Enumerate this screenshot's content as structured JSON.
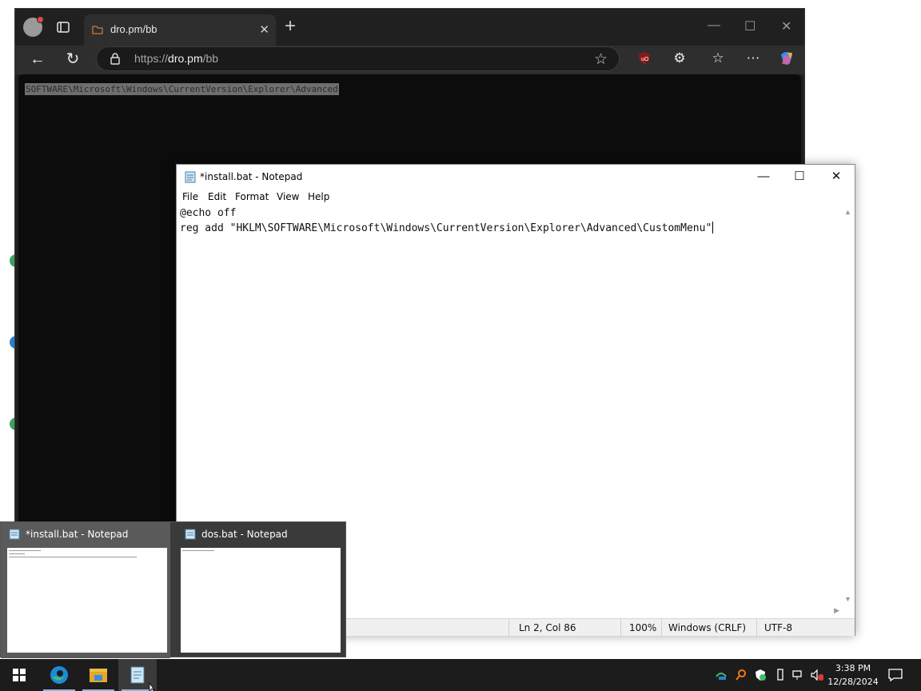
{
  "browser": {
    "tab_title": "dro.pm/bb",
    "url_scheme": "https://",
    "url_host": "dro.pm",
    "url_path": "/bb",
    "content_text": "SOFTWARE\\Microsoft\\Windows\\CurrentVersion\\Explorer\\Advanced"
  },
  "notepad": {
    "title": "*install.bat - Notepad",
    "menu": [
      "File",
      "Edit",
      "Format",
      "View",
      "Help"
    ],
    "lines": [
      "@echo off",
      "reg add \"HKLM\\SOFTWARE\\Microsoft\\Windows\\CurrentVersion\\Explorer\\Advanced\\CustomMenu\""
    ],
    "status": {
      "position": "Ln 2, Col 86",
      "zoom": "100%",
      "line_endings": "Windows (CRLF)",
      "encoding": "UTF-8"
    }
  },
  "flyout": {
    "thumbnails": [
      {
        "title": "*install.bat - Notepad"
      },
      {
        "title": "dos.bat - Notepad"
      }
    ]
  },
  "taskbar": {
    "time": "3:38 PM",
    "date": "12/28/2024",
    "icons": [
      "start-icon",
      "edge-icon",
      "file-explorer-icon",
      "notepad-icon"
    ]
  },
  "colors": {
    "browser_bg": "#202020",
    "content_bg": "#0c0c0c",
    "taskbar_bg": "#1c1c1c",
    "flyout_bg": "#3a3a3a"
  }
}
